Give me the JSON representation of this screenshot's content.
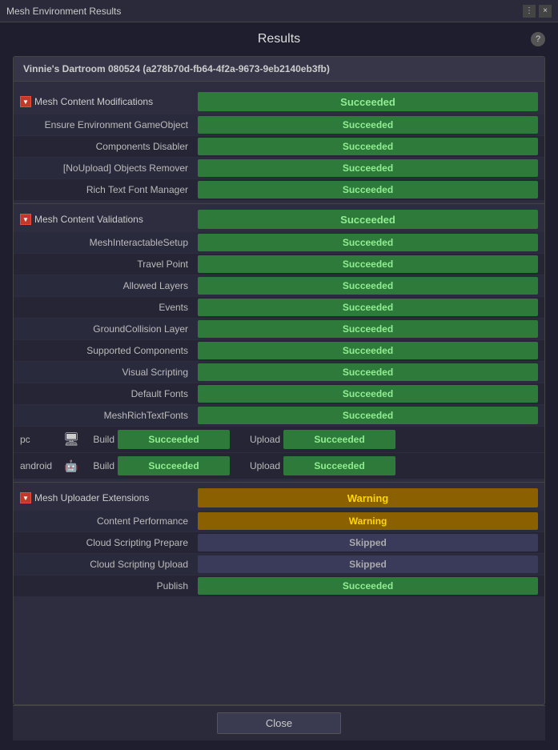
{
  "titleBar": {
    "title": "Mesh Environment Results",
    "controls": [
      "⋮",
      "×"
    ]
  },
  "page": {
    "title": "Results",
    "helpIcon": "?"
  },
  "panelHeader": {
    "text": "Vinnie's Dartroom 080524 (a278b70d-fb64-4f2a-9673-9eb2140eb3fb)"
  },
  "sections": [
    {
      "id": "mesh-content-modifications",
      "name": "Mesh Content Modifications",
      "status": "Succeeded",
      "statusType": "succeeded",
      "items": [
        {
          "label": "Ensure Environment GameObject",
          "status": "Succeeded",
          "statusType": "succeeded"
        },
        {
          "label": "Components Disabler",
          "status": "Succeeded",
          "statusType": "succeeded"
        },
        {
          "label": "[NoUpload] Objects Remover",
          "status": "Succeeded",
          "statusType": "succeeded"
        },
        {
          "label": "Rich Text Font Manager",
          "status": "Succeeded",
          "statusType": "succeeded"
        }
      ]
    },
    {
      "id": "mesh-content-validations",
      "name": "Mesh Content Validations",
      "status": "Succeeded",
      "statusType": "succeeded",
      "items": [
        {
          "label": "MeshInteractableSetup",
          "status": "Succeeded",
          "statusType": "succeeded"
        },
        {
          "label": "Travel Point",
          "status": "Succeeded",
          "statusType": "succeeded"
        },
        {
          "label": "Allowed Layers",
          "status": "Succeeded",
          "statusType": "succeeded"
        },
        {
          "label": "Events",
          "status": "Succeeded",
          "statusType": "succeeded"
        },
        {
          "label": "GroundCollision Layer",
          "status": "Succeeded",
          "statusType": "succeeded"
        },
        {
          "label": "Supported Components",
          "status": "Succeeded",
          "statusType": "succeeded"
        },
        {
          "label": "Visual Scripting",
          "status": "Succeeded",
          "statusType": "succeeded"
        },
        {
          "label": "Default Fonts",
          "status": "Succeeded",
          "statusType": "succeeded"
        },
        {
          "label": "MeshRichTextFonts",
          "status": "Succeeded",
          "statusType": "succeeded"
        }
      ],
      "platforms": [
        {
          "name": "pc",
          "icon": "🖥",
          "buildLabel": "Build",
          "buildStatus": "Succeeded",
          "buildStatusType": "succeeded",
          "uploadLabel": "Upload",
          "uploadStatus": "Succeeded",
          "uploadStatusType": "succeeded"
        },
        {
          "name": "android",
          "icon": "🤖",
          "buildLabel": "Build",
          "buildStatus": "Succeeded",
          "buildStatusType": "succeeded",
          "uploadLabel": "Upload",
          "uploadStatus": "Succeeded",
          "uploadStatusType": "succeeded"
        }
      ]
    },
    {
      "id": "mesh-uploader-extensions",
      "name": "Mesh Uploader Extensions",
      "status": "Warning",
      "statusType": "warning",
      "items": [
        {
          "label": "Content Performance",
          "status": "Warning",
          "statusType": "warning"
        },
        {
          "label": "Cloud Scripting Prepare",
          "status": "Skipped",
          "statusType": "skipped"
        },
        {
          "label": "Cloud Scripting Upload",
          "status": "Skipped",
          "statusType": "skipped"
        },
        {
          "label": "Publish",
          "status": "Succeeded",
          "statusType": "succeeded"
        }
      ]
    }
  ],
  "closeButton": {
    "label": "Close"
  }
}
